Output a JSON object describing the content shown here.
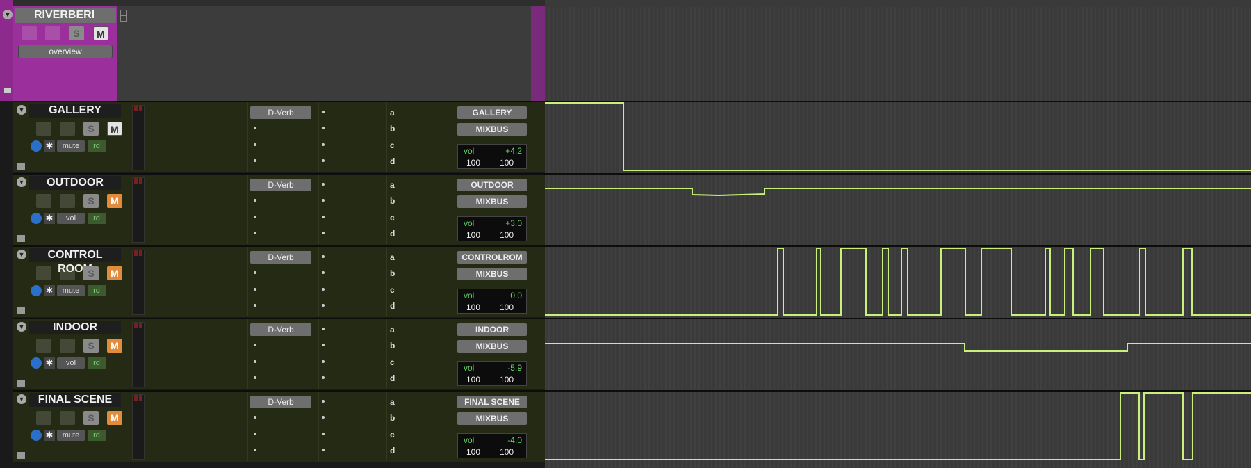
{
  "folder": {
    "name": "RIVERBERI",
    "solo_label": "S",
    "mute_label": "M",
    "view_label": "overview"
  },
  "tracks": [
    {
      "name": "GALLERY",
      "solo_label": "S",
      "mute_label": "M",
      "mute_active": false,
      "view": "mute",
      "rd": "rd",
      "insert": "D-Verb",
      "letters": [
        "a",
        "b",
        "c",
        "d"
      ],
      "send_name": "GALLERY",
      "bus_name": "MIXBUS",
      "vol_label": "vol",
      "vol_value": "+4.2",
      "pan_left": "100",
      "pan_right": "100"
    },
    {
      "name": "OUTDOOR",
      "solo_label": "S",
      "mute_label": "M",
      "mute_active": true,
      "view": "vol",
      "rd": "rd",
      "insert": "D-Verb",
      "letters": [
        "a",
        "b",
        "c",
        "d"
      ],
      "send_name": "OUTDOOR",
      "bus_name": "MIXBUS",
      "vol_label": "vol",
      "vol_value": "+3.0",
      "pan_left": "100",
      "pan_right": "100"
    },
    {
      "name": "CONTROL ROOM",
      "solo_label": "S",
      "mute_label": "M",
      "mute_active": true,
      "view": "mute",
      "rd": "rd",
      "insert": "D-Verb",
      "letters": [
        "a",
        "b",
        "c",
        "d"
      ],
      "send_name": "CONTROLROM",
      "bus_name": "MIXBUS",
      "vol_label": "vol",
      "vol_value": "0.0",
      "pan_left": "100",
      "pan_right": "100"
    },
    {
      "name": "INDOOR",
      "solo_label": "S",
      "mute_label": "M",
      "mute_active": true,
      "view": "vol",
      "rd": "rd",
      "insert": "D-Verb",
      "letters": [
        "a",
        "b",
        "c",
        "d"
      ],
      "send_name": "INDOOR",
      "bus_name": "MIXBUS",
      "vol_label": "vol",
      "vol_value": "-5.9",
      "pan_left": "100",
      "pan_right": "100"
    },
    {
      "name": "FINAL SCENE",
      "solo_label": "S",
      "mute_label": "M",
      "mute_active": true,
      "view": "mute",
      "rd": "rd",
      "insert": "D-Verb",
      "letters": [
        "a",
        "b",
        "c",
        "d"
      ],
      "send_name": "FINAL SCENE",
      "bus_name": "MIXBUS",
      "vol_label": "vol",
      "vol_value": "-4.0",
      "pan_left": "100",
      "pan_right": "100"
    }
  ],
  "colors": {
    "folder": "#9b2f9b",
    "track_bg": "#242a14",
    "automation_line": "#c8f07a",
    "mute_active": "#e08c3c",
    "vol_text": "#5fd35f"
  }
}
